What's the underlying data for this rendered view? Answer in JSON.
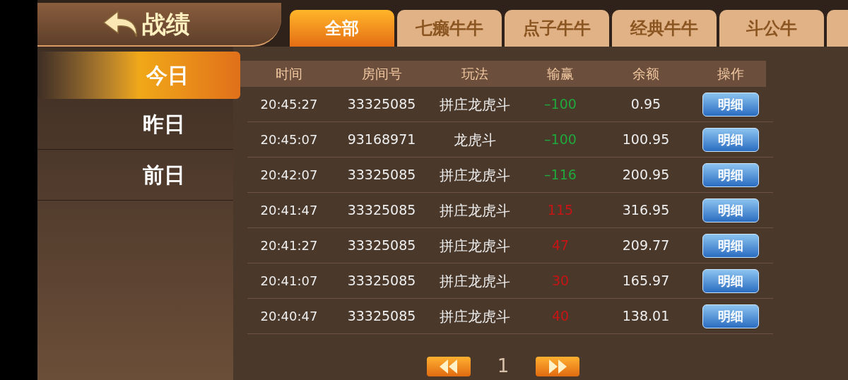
{
  "header": {
    "title": "战绩"
  },
  "tabs": [
    {
      "label": "全部",
      "selected": true
    },
    {
      "label": "七癞牛牛",
      "selected": false
    },
    {
      "label": "点子牛牛",
      "selected": false
    },
    {
      "label": "经典牛牛",
      "selected": false
    },
    {
      "label": "斗公牛",
      "selected": false
    }
  ],
  "sidebar": {
    "items": [
      {
        "label": "今日",
        "selected": true
      },
      {
        "label": "昨日",
        "selected": false
      },
      {
        "label": "前日",
        "selected": false
      }
    ]
  },
  "table": {
    "columns": [
      "时间",
      "房间号",
      "玩法",
      "输赢",
      "余额",
      "操作"
    ],
    "rows": [
      {
        "time": "20:45:27",
        "room": "33325085",
        "game": "拼庄龙虎斗",
        "result": "–100",
        "kind": "loss",
        "balance": "0.95",
        "action": "明细"
      },
      {
        "time": "20:45:07",
        "room": "93168971",
        "game": "龙虎斗",
        "result": "–100",
        "kind": "loss",
        "balance": "100.95",
        "action": "明细"
      },
      {
        "time": "20:42:07",
        "room": "33325085",
        "game": "拼庄龙虎斗",
        "result": "–116",
        "kind": "loss",
        "balance": "200.95",
        "action": "明细"
      },
      {
        "time": "20:41:47",
        "room": "33325085",
        "game": "拼庄龙虎斗",
        "result": "115",
        "kind": "win",
        "balance": "316.95",
        "action": "明细"
      },
      {
        "time": "20:41:27",
        "room": "33325085",
        "game": "拼庄龙虎斗",
        "result": "47",
        "kind": "win",
        "balance": "209.77",
        "action": "明细"
      },
      {
        "time": "20:41:07",
        "room": "33325085",
        "game": "拼庄龙虎斗",
        "result": "30",
        "kind": "win",
        "balance": "165.97",
        "action": "明细"
      },
      {
        "time": "20:40:47",
        "room": "33325085",
        "game": "拼庄龙虎斗",
        "result": "40",
        "kind": "win",
        "balance": "138.01",
        "action": "明细"
      }
    ]
  },
  "pager": {
    "page": "1"
  }
}
